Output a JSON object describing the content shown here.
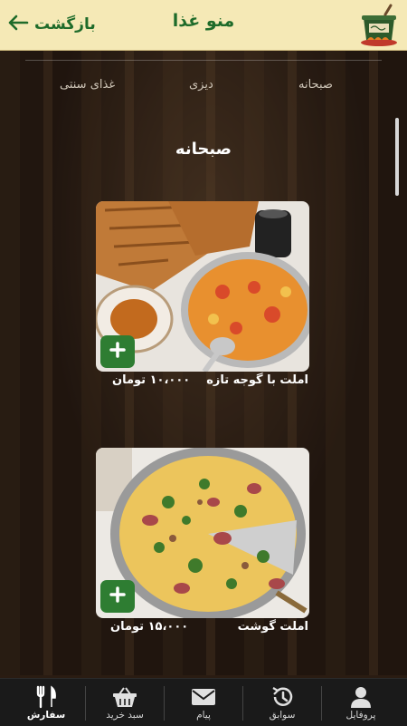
{
  "header": {
    "title": "منو غذا",
    "back_label": "بازگشت"
  },
  "tabs": [
    {
      "label": "صبحانه"
    },
    {
      "label": "دیزی"
    },
    {
      "label": "غذای سنتی"
    }
  ],
  "section": {
    "title": "صبحانه"
  },
  "items": [
    {
      "name": "املت با گوجه تازه",
      "price": "۱۰،۰۰۰ تومان"
    },
    {
      "name": "املت گوشت",
      "price": "۱۵،۰۰۰ تومان"
    }
  ],
  "nav": [
    {
      "label": "پروفایل",
      "icon": "user-icon"
    },
    {
      "label": "سوابق",
      "icon": "history-icon"
    },
    {
      "label": "پیام",
      "icon": "mail-icon"
    },
    {
      "label": "سبد خرید",
      "icon": "basket-icon"
    },
    {
      "label": "سفارش",
      "icon": "fork-knife-icon"
    }
  ],
  "colors": {
    "header_bg": "#f5e9b6",
    "accent_green": "#1e6b2a",
    "add_button": "#2e7d32",
    "nav_bg": "#1a1a1a"
  }
}
